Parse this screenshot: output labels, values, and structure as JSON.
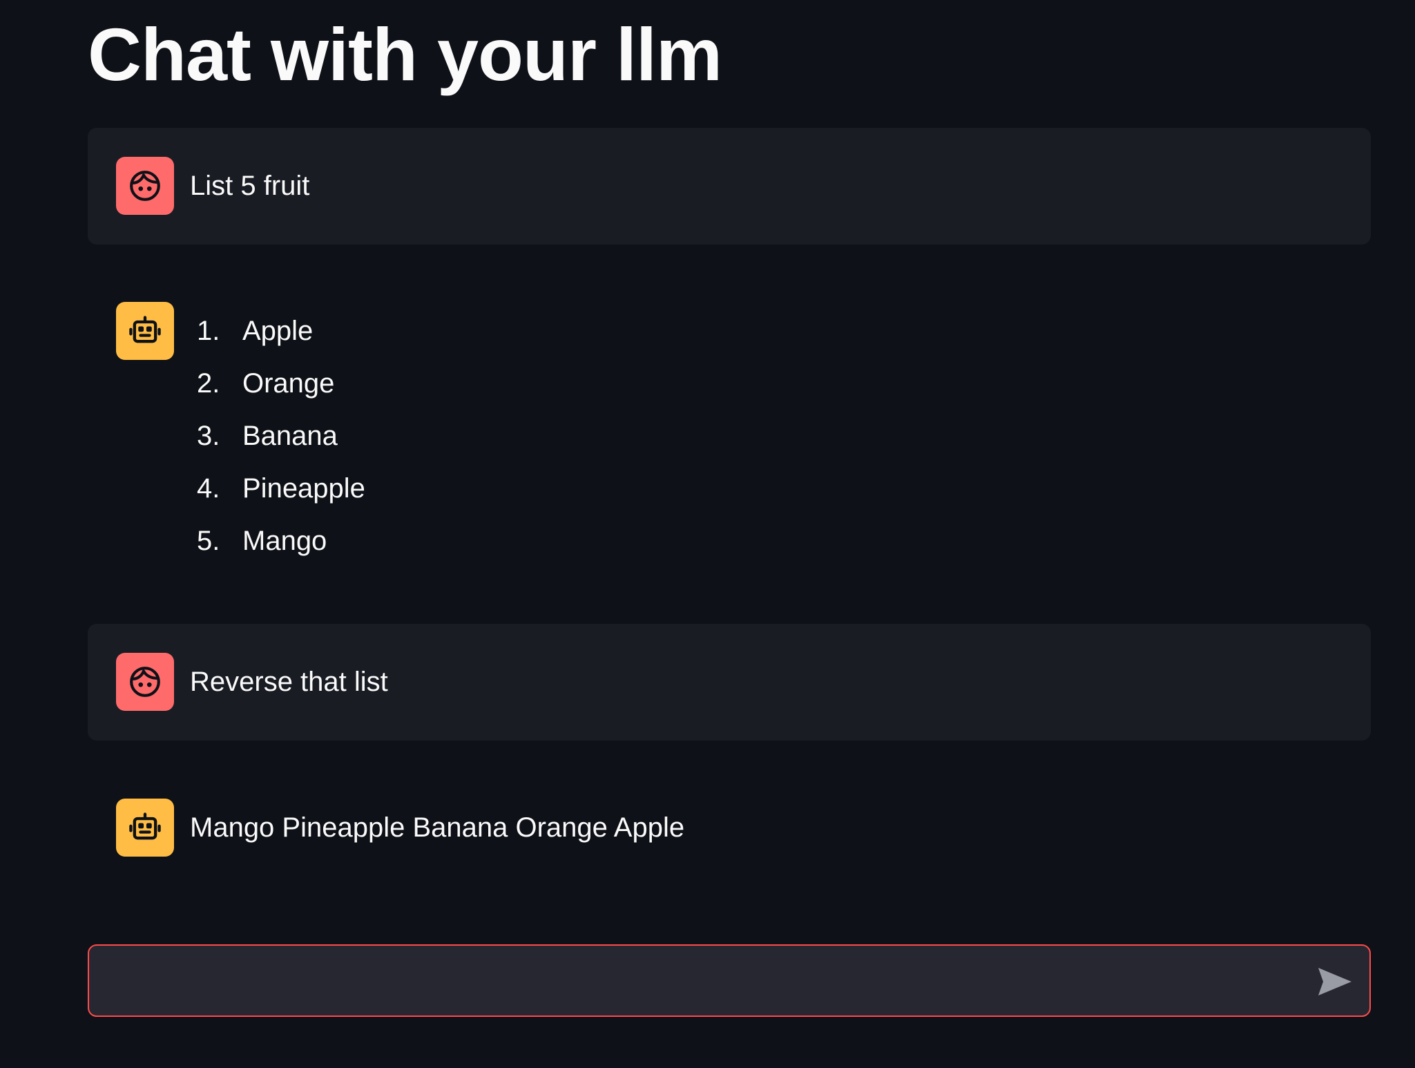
{
  "page": {
    "title": "Chat with your llm"
  },
  "messages": [
    {
      "role": "user",
      "avatar_icon": "user-face-icon",
      "text": "List 5 fruit"
    },
    {
      "role": "assistant",
      "avatar_icon": "robot-icon",
      "list": [
        {
          "num": "1.",
          "label": "Apple"
        },
        {
          "num": "2.",
          "label": "Orange"
        },
        {
          "num": "3.",
          "label": "Banana"
        },
        {
          "num": "4.",
          "label": "Pineapple"
        },
        {
          "num": "5.",
          "label": "Mango"
        }
      ]
    },
    {
      "role": "user",
      "avatar_icon": "user-face-icon",
      "text": "Reverse that list"
    },
    {
      "role": "assistant",
      "avatar_icon": "robot-icon",
      "text": "Mango Pineapple Banana Orange Apple"
    }
  ],
  "chat_input": {
    "value": "",
    "placeholder": "",
    "send_icon": "send-icon"
  },
  "colors": {
    "background": "#0e1117",
    "user_bubble": "#1a1c24",
    "user_avatar": "#ff6b6b",
    "assistant_avatar": "#ffbd45",
    "input_border": "#ff4b4b",
    "input_bg": "#262730"
  }
}
